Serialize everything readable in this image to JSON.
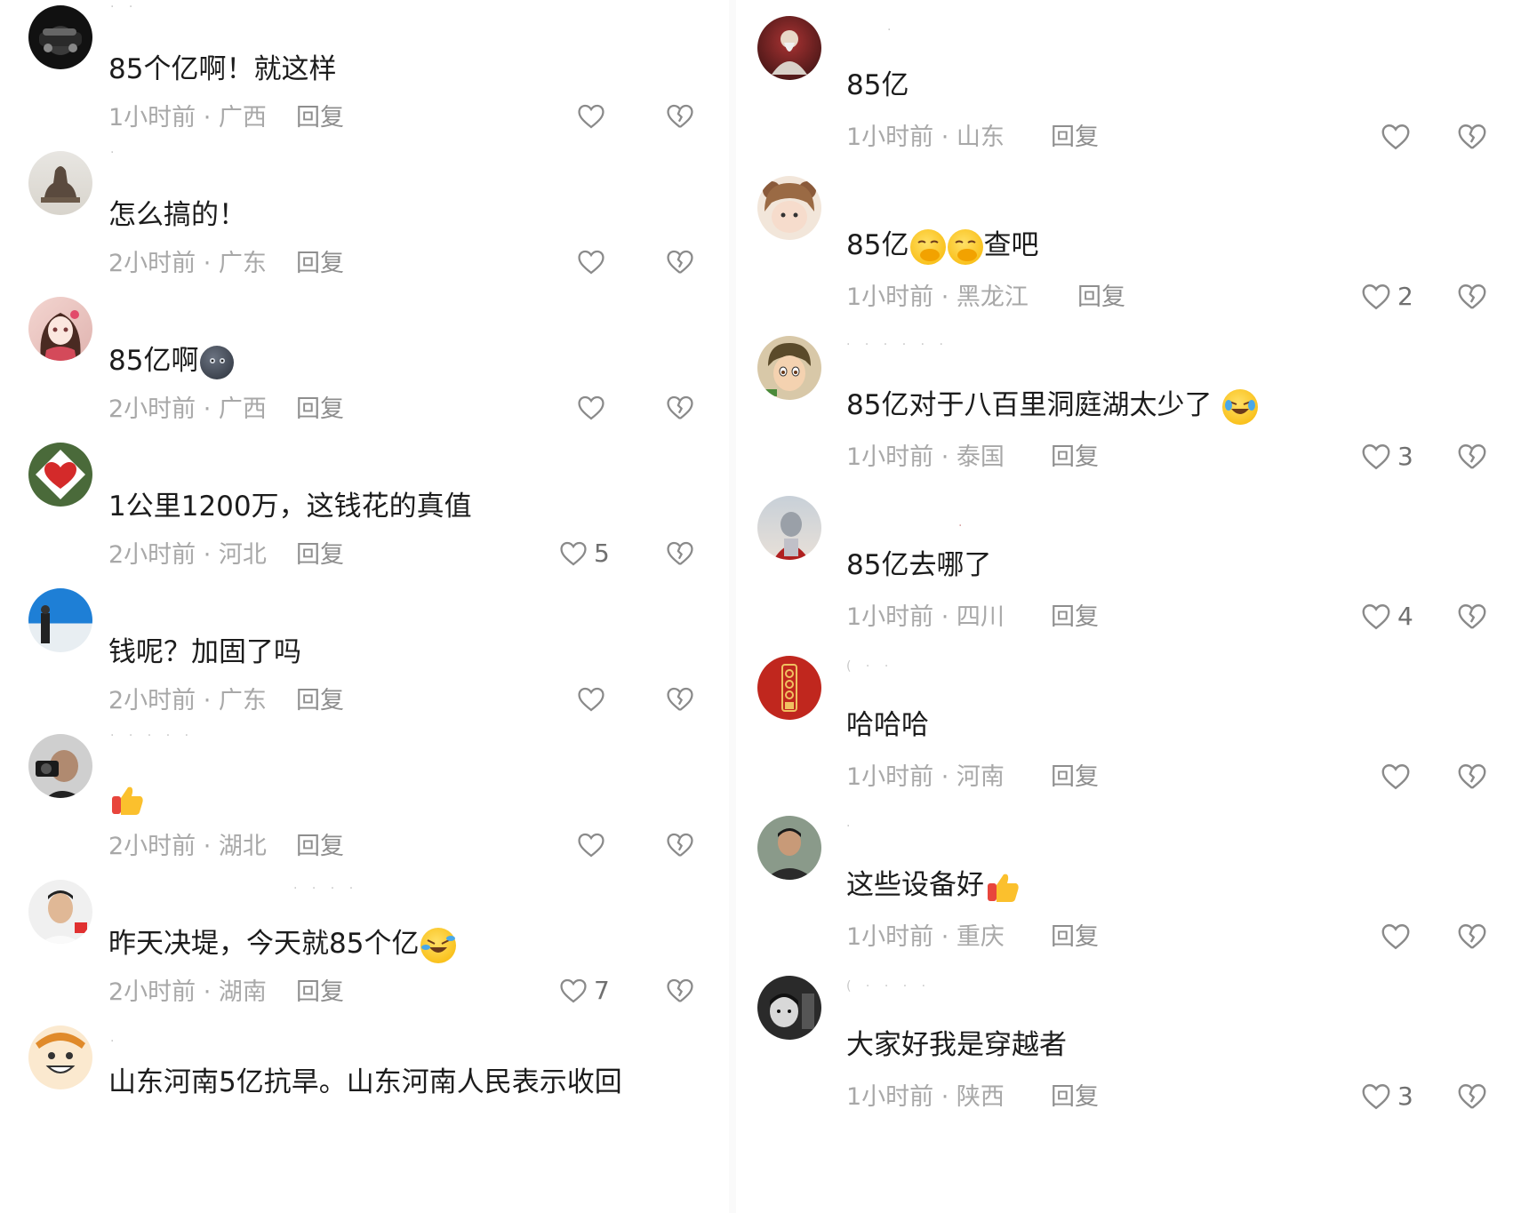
{
  "reply_label": "回复",
  "left": [
    {
      "text": "85个亿啊！就这样",
      "meta": "1小时前 · 广西",
      "likes": "",
      "avatar": "car"
    },
    {
      "text": "怎么搞的！",
      "meta": "2小时前 · 广东",
      "likes": "",
      "avatar": "statue"
    },
    {
      "text": "85亿啊",
      "meta": "2小时前 · 广西",
      "likes": "",
      "avatar": "anime-girl"
    },
    {
      "text": "1公里1200万，这钱花的真值",
      "meta": "2小时前 · 河北",
      "likes": "5",
      "avatar": "green-heart"
    },
    {
      "text": "钱呢？加固了吗",
      "meta": "2小时前 · 广东",
      "likes": "",
      "avatar": "sky-person"
    },
    {
      "text": "",
      "meta": "2小时前 · 湖北",
      "likes": "",
      "avatar": "camera-man"
    },
    {
      "text": "昨天决堤，今天就85个亿",
      "meta": "2小时前 · 湖南",
      "likes": "7",
      "avatar": "young-man"
    },
    {
      "text": "山东河南5亿抗旱。山东河南人民表示收回",
      "meta": "",
      "likes": "",
      "avatar": "cartoon-face"
    }
  ],
  "right": [
    {
      "text": "85亿",
      "meta": "1小时前 · 山东",
      "likes": "",
      "avatar": "monk"
    },
    {
      "text": "85亿",
      "text_suffix": "查吧",
      "meta": "1小时前 · 黑龙江",
      "likes": "2",
      "avatar": "bear-baby"
    },
    {
      "text": "85亿对于八百里洞庭湖太少了",
      "meta": "1小时前 · 泰国",
      "likes": "3",
      "avatar": "anime-boy"
    },
    {
      "text": "85亿去哪了",
      "meta": "1小时前 · 四川",
      "likes": "4",
      "avatar": "ultraman"
    },
    {
      "text": "哈哈哈",
      "meta": "1小时前 · 河南",
      "likes": "",
      "avatar": "red-seal"
    },
    {
      "text": "这些设备好",
      "meta": "1小时前 · 重庆",
      "likes": "",
      "avatar": "man-jacket"
    },
    {
      "text": "大家好我是穿越者",
      "meta": "1小时前 · 陕西",
      "likes": "3",
      "avatar": "bw-child"
    }
  ],
  "colors": {
    "text": "#1c1c1c",
    "meta": "#a8a8a8",
    "reply": "#8e8e8e",
    "icon": "#8a8a8a"
  }
}
